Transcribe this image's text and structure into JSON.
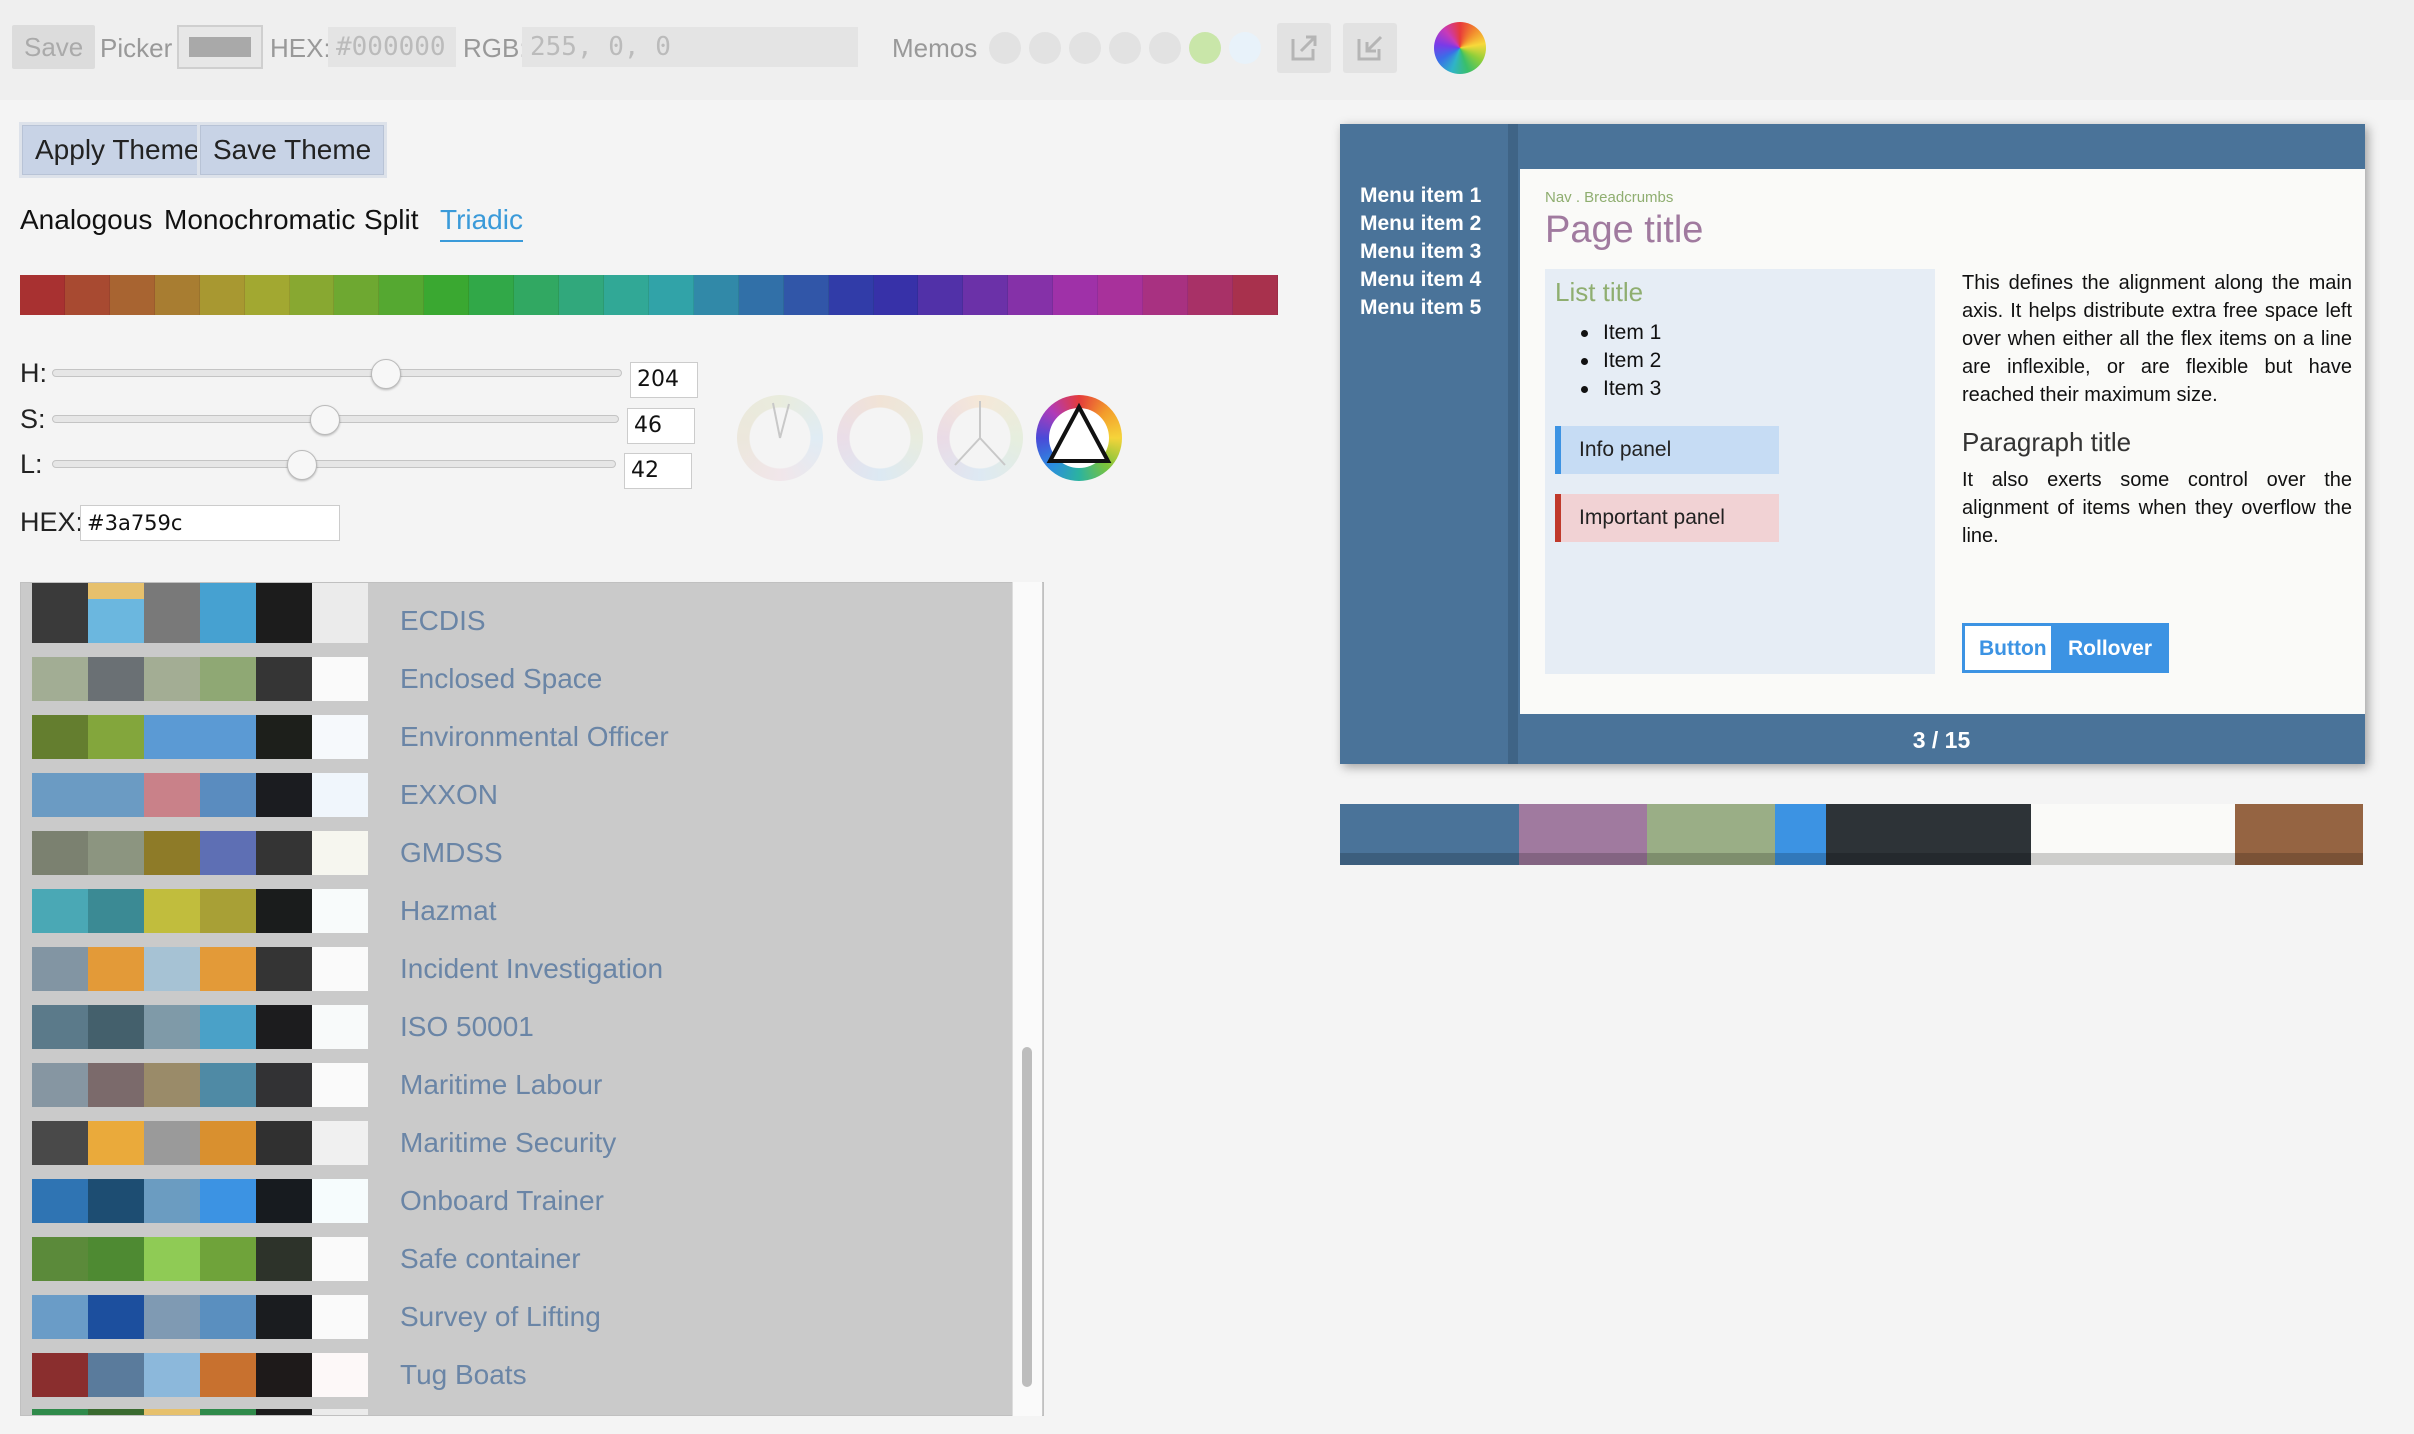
{
  "toolbar": {
    "save_label": "Save",
    "picker_label": "Picker",
    "hex_label": "HEX:",
    "hex_value": "#000000",
    "rgb_label": "RGB:",
    "rgb_value": "255, 0, 0",
    "memos_label": "Memos",
    "memo_colors": [
      "#e2e2e2",
      "#e2e2e2",
      "#e2e2e2",
      "#e2e2e2",
      "#e2e2e2",
      "#c9e6a9",
      "#e8f2fa"
    ]
  },
  "theme_buttons": {
    "apply_label": "Apply Theme",
    "save_label": "Save Theme"
  },
  "scheme_tabs": [
    {
      "label": "Analogous",
      "active": false
    },
    {
      "label": "Monochromatic",
      "active": false
    },
    {
      "label": "Split",
      "active": false
    },
    {
      "label": "Triadic",
      "active": true
    }
  ],
  "hue_strip": [
    "#a83131",
    "#a84a31",
    "#a86431",
    "#a87d31",
    "#a89831",
    "#a2a831",
    "#88a831",
    "#6ea831",
    "#55a831",
    "#3aa831",
    "#31a848",
    "#31a862",
    "#31a87c",
    "#31a896",
    "#31a3a8",
    "#3189a8",
    "#3170a8",
    "#3156a8",
    "#313ca8",
    "#3731a8",
    "#5131a8",
    "#6b31a8",
    "#8531a8",
    "#9f31a8",
    "#a8319b",
    "#a83181",
    "#a83167",
    "#a8314d"
  ],
  "sliders": [
    {
      "label": "H:",
      "value": "204",
      "fraction": 0.57
    },
    {
      "label": "S:",
      "value": "46",
      "fraction": 0.46
    },
    {
      "label": "L:",
      "value": "42",
      "fraction": 0.42
    }
  ],
  "hex_input": {
    "label": "HEX:",
    "value": "#3a759c"
  },
  "scheme_modes": [
    "analogous",
    "monochromatic",
    "split",
    "triadic"
  ],
  "accent_color": "#3a759c",
  "presets": [
    {
      "name": "ECDIS",
      "colors": [
        "#3a3a3a",
        "#6bb7df",
        "#797979",
        "#46a1d1",
        "#1c1c1c",
        "#ebebeb"
      ]
    },
    {
      "name": "Enclosed Space",
      "colors": [
        "#a2ad94",
        "#6a7074",
        "#a3ad94",
        "#8fa874",
        "#353535",
        "#fafafa"
      ]
    },
    {
      "name": "Environmental Officer",
      "colors": [
        "#647e2f",
        "#83a63c",
        "#5b9ad4",
        "#5b9ad4",
        "#1d1f1b",
        "#f6f9fc"
      ]
    },
    {
      "name": "EXXON",
      "colors": [
        "#6b9bc3",
        "#6b9bc3",
        "#c98189",
        "#5a8cbf",
        "#1b1c20",
        "#f0f6fc"
      ]
    },
    {
      "name": "GMDSS",
      "colors": [
        "#7b8170",
        "#8c9580",
        "#8e7b28",
        "#5e6fb4",
        "#343434",
        "#f6f6ef"
      ]
    },
    {
      "name": "Hazmat",
      "colors": [
        "#4aa8b5",
        "#3b8a94",
        "#c1bd3d",
        "#a8a036",
        "#1a1c1c",
        "#f8fbfb"
      ]
    },
    {
      "name": "Incident Investigation",
      "colors": [
        "#8295a3",
        "#e39a38",
        "#a6c2d4",
        "#e39a38",
        "#343434",
        "#fafafa"
      ]
    },
    {
      "name": "ISO 50001",
      "colors": [
        "#5b7a8a",
        "#44606c",
        "#7f9aa8",
        "#4aa1c8",
        "#1c1c1e",
        "#f8fafa"
      ]
    },
    {
      "name": "Maritime Labour",
      "colors": [
        "#8696a2",
        "#7b6a6b",
        "#9a8b69",
        "#4f8aa5",
        "#323234",
        "#fafafa"
      ]
    },
    {
      "name": "Maritime Security",
      "colors": [
        "#494949",
        "#eaaa3b",
        "#9a9a9a",
        "#d9902f",
        "#303030",
        "#f0f0f0"
      ]
    },
    {
      "name": "Onboard Trainer",
      "colors": [
        "#2f74b3",
        "#1d4d72",
        "#6b9cc1",
        "#3c93e3",
        "#171b1f",
        "#f6fcfd"
      ]
    },
    {
      "name": "Safe container",
      "colors": [
        "#5b8a3a",
        "#4e8a32",
        "#8fcb55",
        "#6fa33a",
        "#2d332a",
        "#fafafa"
      ]
    },
    {
      "name": "Survey of Lifting",
      "colors": [
        "#6a9cc7",
        "#1c4f9e",
        "#7f9ab3",
        "#5a8fbf",
        "#1a1c1f",
        "#fafafa"
      ]
    },
    {
      "name": "Tug Boats",
      "colors": [
        "#8a2e2e",
        "#5a7b9c",
        "#8cb8db",
        "#c8712f",
        "#1e1a1a",
        "#fdf8f8"
      ]
    }
  ],
  "preview": {
    "menu_items": [
      "Menu item 1",
      "Menu item 2",
      "Menu item 3",
      "Menu item 4",
      "Menu item 5"
    ],
    "breadcrumbs": "Nav . Breadcrumbs",
    "page_title": "Page title",
    "list_title": "List title",
    "list_items": [
      "Item 1",
      "Item 2",
      "Item 3"
    ],
    "info_panel": "Info panel",
    "important_panel": "Important panel",
    "paragraph_1": "This defines the alignment along the main axis. It helps distribute extra free space left over when either all the flex items on a line are inflexible, or are flexible but have reached their maximum size.",
    "paragraph_title": "Paragraph title",
    "paragraph_2": "It also exerts some control over the alignment of items when they overflow the line.",
    "button_label": "Button",
    "rollover_label": "Rollover",
    "pagination": "3 / 15",
    "colors": {
      "primary": "#4a7399",
      "accent": "#3c93e3",
      "title": "#a07a9f",
      "green": "#8fae70",
      "important": "#c0392b"
    }
  },
  "palette": [
    {
      "color": "#4a7399",
      "weight": 3.5
    },
    {
      "color": "#a07a9f",
      "weight": 2.5
    },
    {
      "color": "#9aae86",
      "weight": 2.5
    },
    {
      "color": "#3c93e3",
      "weight": 1
    },
    {
      "color": "#2d3337",
      "weight": 4
    },
    {
      "color": "#fafaf8",
      "weight": 4
    },
    {
      "color": "#956442",
      "weight": 2.5
    }
  ]
}
